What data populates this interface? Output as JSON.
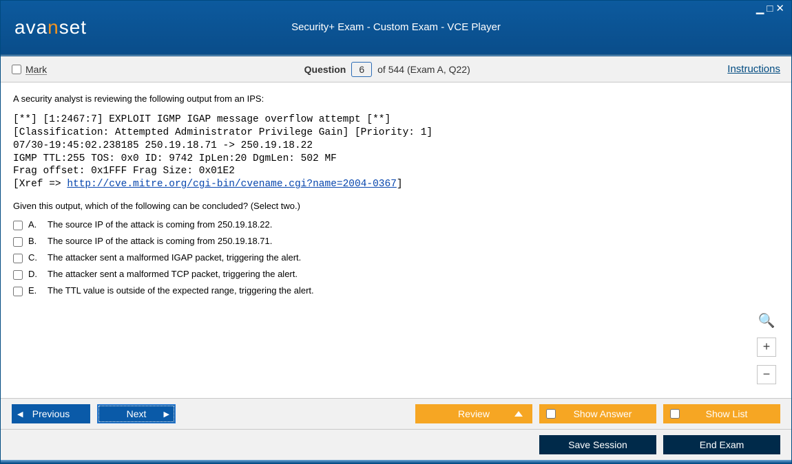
{
  "window": {
    "title": "Security+ Exam - Custom Exam - VCE Player",
    "logo_seg1": "ava",
    "logo_seg_n": "n",
    "logo_seg2": "set"
  },
  "infobar": {
    "mark_label": "Mark",
    "question_word": "Question",
    "question_number": "6",
    "of_text": "of 544 (Exam A, Q22)",
    "instructions_label": "Instructions"
  },
  "question": {
    "intro": "A security analyst is reviewing the following output from an IPS:",
    "ips_line1": "[**] [1:2467:7] EXPLOIT IGMP IGAP message overflow attempt [**]",
    "ips_line2": "[Classification: Attempted Administrator Privilege Gain] [Priority: 1]",
    "ips_line3": "07/30-19:45:02.238185 250.19.18.71 -> 250.19.18.22",
    "ips_line4": "IGMP TTL:255 TOS: 0x0 ID: 9742 IpLen:20 DgmLen: 502 MF",
    "ips_line5": "Frag offset: 0x1FFF Frag Size: 0x01E2",
    "ips_xref_pre": "[Xref => ",
    "ips_xref_link": "http://cve.mitre.org/cgi-bin/cvename.cgi?name=2004-0367",
    "ips_xref_post": "]",
    "sub": "Given this output, which of the following can be concluded? (Select two.)",
    "options": [
      {
        "letter": "A.",
        "text": "The source IP of the attack is coming from 250.19.18.22."
      },
      {
        "letter": "B.",
        "text": "The source IP of the attack is coming from 250.19.18.71."
      },
      {
        "letter": "C.",
        "text": "The attacker sent a malformed IGAP packet, triggering the alert."
      },
      {
        "letter": "D.",
        "text": "The attacker sent a malformed TCP packet, triggering the alert."
      },
      {
        "letter": "E.",
        "text": "The TTL value is outside of the expected range, triggering the alert."
      }
    ]
  },
  "buttons": {
    "previous": "Previous",
    "next": "Next",
    "review": "Review",
    "show_answer": "Show Answer",
    "show_list": "Show List",
    "save_session": "Save Session",
    "end_exam": "End Exam"
  },
  "zoom": {
    "plus": "+",
    "minus": "−"
  }
}
